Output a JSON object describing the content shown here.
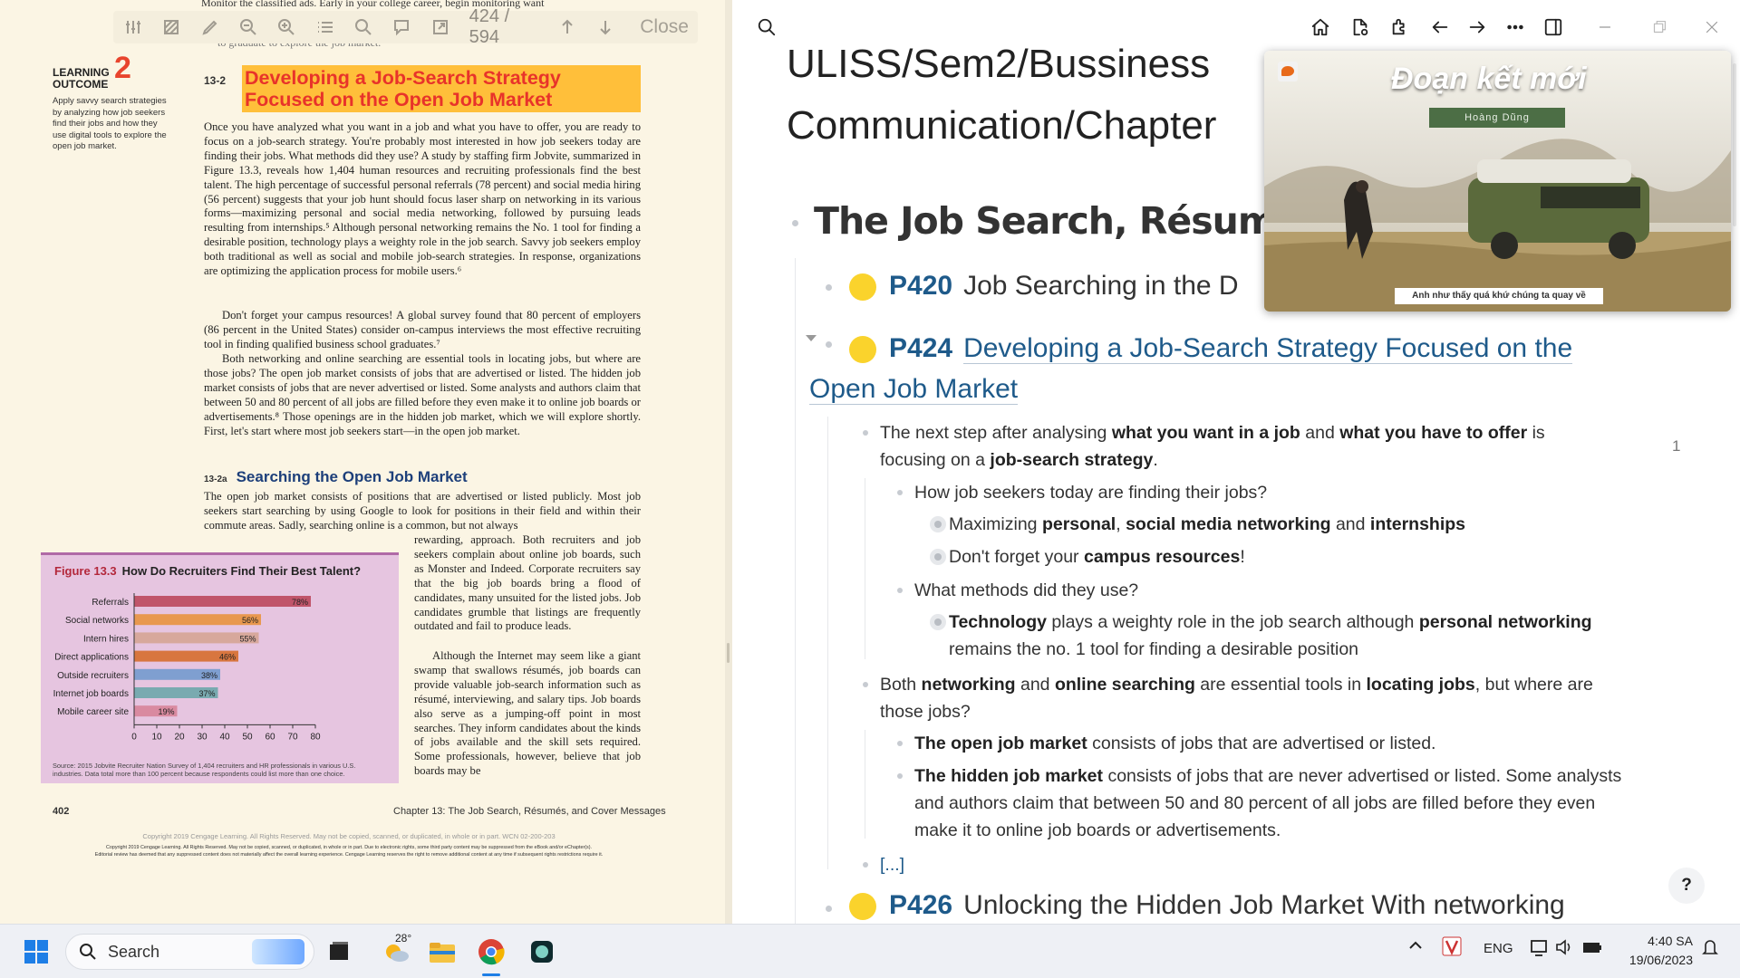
{
  "pdf": {
    "toolbar": {
      "page_current": "424",
      "page_total": "/ 594",
      "close_label": "Close"
    },
    "top_line": "Monitor the classified ads. Early in your college career, begin monitoring want",
    "top_line2": "to graduate to explore the job market.",
    "learning_outcome": {
      "label": "LEARNING OUTCOME",
      "number": "2",
      "description": "Apply savvy search strategies by analyzing how job seekers find their jobs and how they use digital tools to explore the open job market."
    },
    "section_number": "13-2",
    "heading": "Developing a Job-Search Strategy Focused on the Open Job Market",
    "para1": "Once you have analyzed what you want in a job and what you have to offer, you are ready to focus on a job-search strategy. You're probably most interested in how job seekers today are finding their jobs. What methods did they use? A study by staffing firm Jobvite, summarized in Figure 13.3, reveals how 1,404 human resources and recruiting professionals find the best talent. The high percentage of successful personal referrals (78 percent) and social media hiring (56 percent) suggests that your job hunt should focus laser sharp on networking in its various forms—maximizing personal and social media networking, followed by pursuing leads resulting from internships.⁵ Although personal networking remains the No. 1 tool for finding a desirable position, technology plays a weighty role in the job search. Savvy job seekers employ both traditional as well as social and mobile job-search strategies. In response, organizations are optimizing the application process for mobile users.⁶",
    "para2": "Don't forget your campus resources! A global survey found that 80 percent of employers (86 percent in the United States) consider on-campus interviews the most effective recruiting tool in finding qualified business school graduates.⁷",
    "para3": "Both networking and online searching are essential tools in locating jobs, but where are those jobs? The open job market consists of jobs that are advertised or listed. The hidden job market consists of jobs that are never advertised or listed. Some analysts and authors claim that between 50 and 80 percent of all jobs are filled before they even make it to online job boards or advertisements.⁸ Those openings are in the hidden job market, which we will explore shortly. First, let's start where most job seekers start—in the open job market.",
    "sub_number": "13-2a",
    "subheading": "Searching the Open Job Market",
    "para4": "The open job market consists of positions that are advertised or listed publicly. Most job seekers start searching by using Google to look for positions in their field and within their commute areas. Sadly, searching online is a common, but not always",
    "para5": "rewarding, approach. Both recruiters and job seekers complain about online job boards, such as Monster and Indeed. Corporate recruiters say that the big job boards bring a flood of candidates, many unsuited for the listed jobs. Job candidates grumble that listings are frequently outdated and fail to produce leads.",
    "para6": "Although the Internet may seem like a giant swamp that swallows résumés, job boards can provide valuable job-search information such as résumé, interviewing, and salary tips. Job boards also serve as a jumping-off point in most searches. They inform candidates about the kinds of jobs available and the skill sets required. Some professionals, however, believe that job boards may be",
    "figure": {
      "label": "Figure 13.3",
      "title": "How Do Recruiters Find Their Best Talent?",
      "source": "Source: 2015 Jobvite Recruiter Nation Survey of 1,404 recruiters and HR professionals in various U.S. industries. Data total more than 100 percent because respondents could list more than one choice."
    },
    "footer_page": "402",
    "footer_chapter": "Chapter 13: The Job Search, Résumés, and Cover Messages",
    "copyright1": "Copyright 2019 Cengage Learning. All Rights Reserved. May not be copied, scanned, or duplicated, in whole or in part.  WCN 02-200-203",
    "copyright2": "Copyright 2019 Cengage Learning. All Rights Reserved. May not be copied, scanned, or duplicated, in whole or in part. Due to electronic rights, some third party content may be suppressed from the eBook and/or eChapter(s).",
    "copyright3": "Editorial review has deemed that any suppressed content does not materially affect the overall learning experience. Cengage Learning reserves the right to remove additional content at any time if subsequent rights restrictions require it."
  },
  "chart_data": {
    "type": "bar",
    "orientation": "horizontal",
    "categories": [
      "Referrals",
      "Social networks",
      "Intern hires",
      "Direct applications",
      "Outside recruiters",
      "Internet job boards",
      "Mobile career site"
    ],
    "values": [
      78,
      56,
      55,
      46,
      38,
      37,
      19
    ],
    "value_labels": [
      "78%",
      "56%",
      "55%",
      "46%",
      "38%",
      "37%",
      "19%"
    ],
    "colors": [
      "#c0556a",
      "#e8984f",
      "#d7a89c",
      "#d8763f",
      "#7f9fd0",
      "#79aab0",
      "#d98aa0"
    ],
    "xlim": [
      0,
      80
    ],
    "xticks": [
      "0",
      "10",
      "20",
      "30",
      "40",
      "50",
      "60",
      "70",
      "80"
    ]
  },
  "notes": {
    "breadcrumb_line1": "ULISS/Sem2/Bussiness",
    "breadcrumb_line2": "Communication/Chapter",
    "main_title": "The Job Search, Résumés",
    "blocks": [
      {
        "tag": "P420",
        "title": "Job Searching in the D"
      },
      {
        "tag": "P424",
        "title_line1": "Developing a Job-Search Strategy Focused on the",
        "title_line2": "Open Job Market"
      },
      {
        "tag": "P426",
        "title": "Unlocking the Hidden Job Market With networking"
      }
    ],
    "l1a_pre": "The next step after analysing ",
    "l1a_b1": "what you want in a job",
    "l1a_mid": " and ",
    "l1a_b2": "what you have to offer",
    "l1a_post": " is",
    "l1b_pre": "focusing on a ",
    "l1b_b": "job-search strategy",
    "l1b_post": ".",
    "ref_count": "1",
    "l2": "How job seekers today are finding their jobs?",
    "l3_pre": "Maximizing ",
    "l3_b1": "personal",
    "l3_c": ", ",
    "l3_b2": "social media networking",
    "l3_and": " and ",
    "l3_b3": "internships",
    "l4_pre": "Don't forget your ",
    "l4_b": "campus resources",
    "l4_post": "!",
    "l5": "What methods did they use?",
    "l6_b1": "Technology",
    "l6_mid": " plays a weighty role in the job search although ",
    "l6_b2": "personal networking",
    "l6b": "remains the no. 1 tool for finding a desirable position",
    "l7_pre": "Both ",
    "l7_b1": "networking",
    "l7_and": " and ",
    "l7_b2": "online searching",
    "l7_mid": " are essential tools in ",
    "l7_b3": "locating jobs",
    "l7_post": ", but where are",
    "l7b": "those jobs?",
    "l8_b": "The open job market",
    "l8_post": " consists of jobs that are advertised or listed.",
    "l9_b": "The hidden job market",
    "l9_post": " consists of jobs that are never advertised or listed. Some analysts",
    "l9b": "and authors claim that between 50 and 80 percent of all jobs are filled before they even",
    "l9c": "make it to online job boards or advertisements.",
    "ellipsis": "[...]",
    "help": "?"
  },
  "video": {
    "title": "Đoạn kết mới",
    "artist": "Hoàng Dũng",
    "caption": "Anh như thấy quá khứ chúng ta quay về"
  },
  "taskbar": {
    "search_placeholder": "Search",
    "weather_temp": "28°",
    "language": "ENG",
    "time": "4:40 SA",
    "date": "19/06/2023"
  }
}
